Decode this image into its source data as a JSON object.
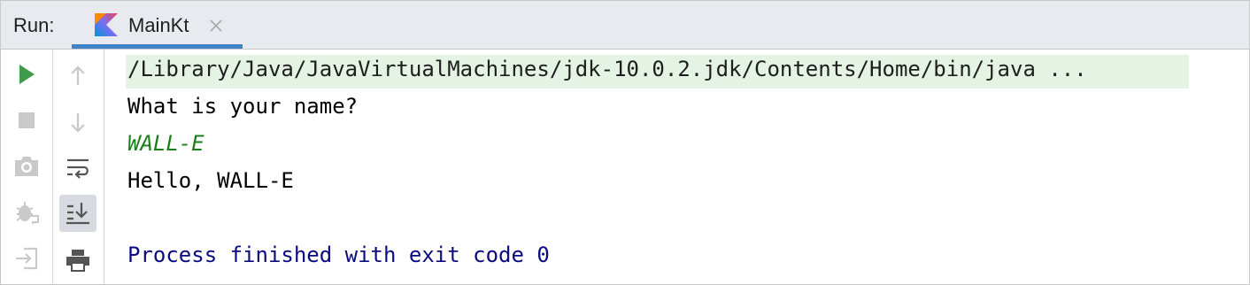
{
  "header": {
    "run_label": "Run:",
    "tab": {
      "title": "MainKt",
      "icon": "kotlin-icon",
      "close_icon": "close-icon"
    }
  },
  "toolbar_left": [
    {
      "name": "rerun-icon",
      "tooltip": "Rerun",
      "color": "#3f9a4a"
    },
    {
      "name": "stop-icon",
      "tooltip": "Stop",
      "color": "#c9c9c9"
    },
    {
      "name": "camera-icon",
      "tooltip": "Dump Threads",
      "color": "#c9c9c9"
    },
    {
      "name": "debug-icon",
      "tooltip": "Debug",
      "color": "#c9c9c9"
    },
    {
      "name": "exit-icon",
      "tooltip": "Exit",
      "color": "#c9c9c9"
    }
  ],
  "toolbar_right": [
    {
      "name": "up-arrow-icon",
      "tooltip": "Up the Stack Trace"
    },
    {
      "name": "down-arrow-icon",
      "tooltip": "Down the Stack Trace"
    },
    {
      "name": "soft-wrap-icon",
      "tooltip": "Soft-Wrap"
    },
    {
      "name": "scroll-to-end-icon",
      "tooltip": "Scroll to the End",
      "active": true
    },
    {
      "name": "print-icon",
      "tooltip": "Print"
    }
  ],
  "console": {
    "command": "/Library/Java/JavaVirtualMachines/jdk-10.0.2.jdk/Contents/Home/bin/java ...",
    "output_prompt": "What is your name?",
    "user_input": "WALL-E",
    "output_greeting": "Hello, WALL-E",
    "exit_message": "Process finished with exit code 0"
  },
  "colors": {
    "header_bg": "#e8eaf0",
    "tab_underline": "#4083c9",
    "command_highlight": "#e4f3e4",
    "user_input_text": "#1a7f1a",
    "exit_text": "#0b0b80"
  }
}
